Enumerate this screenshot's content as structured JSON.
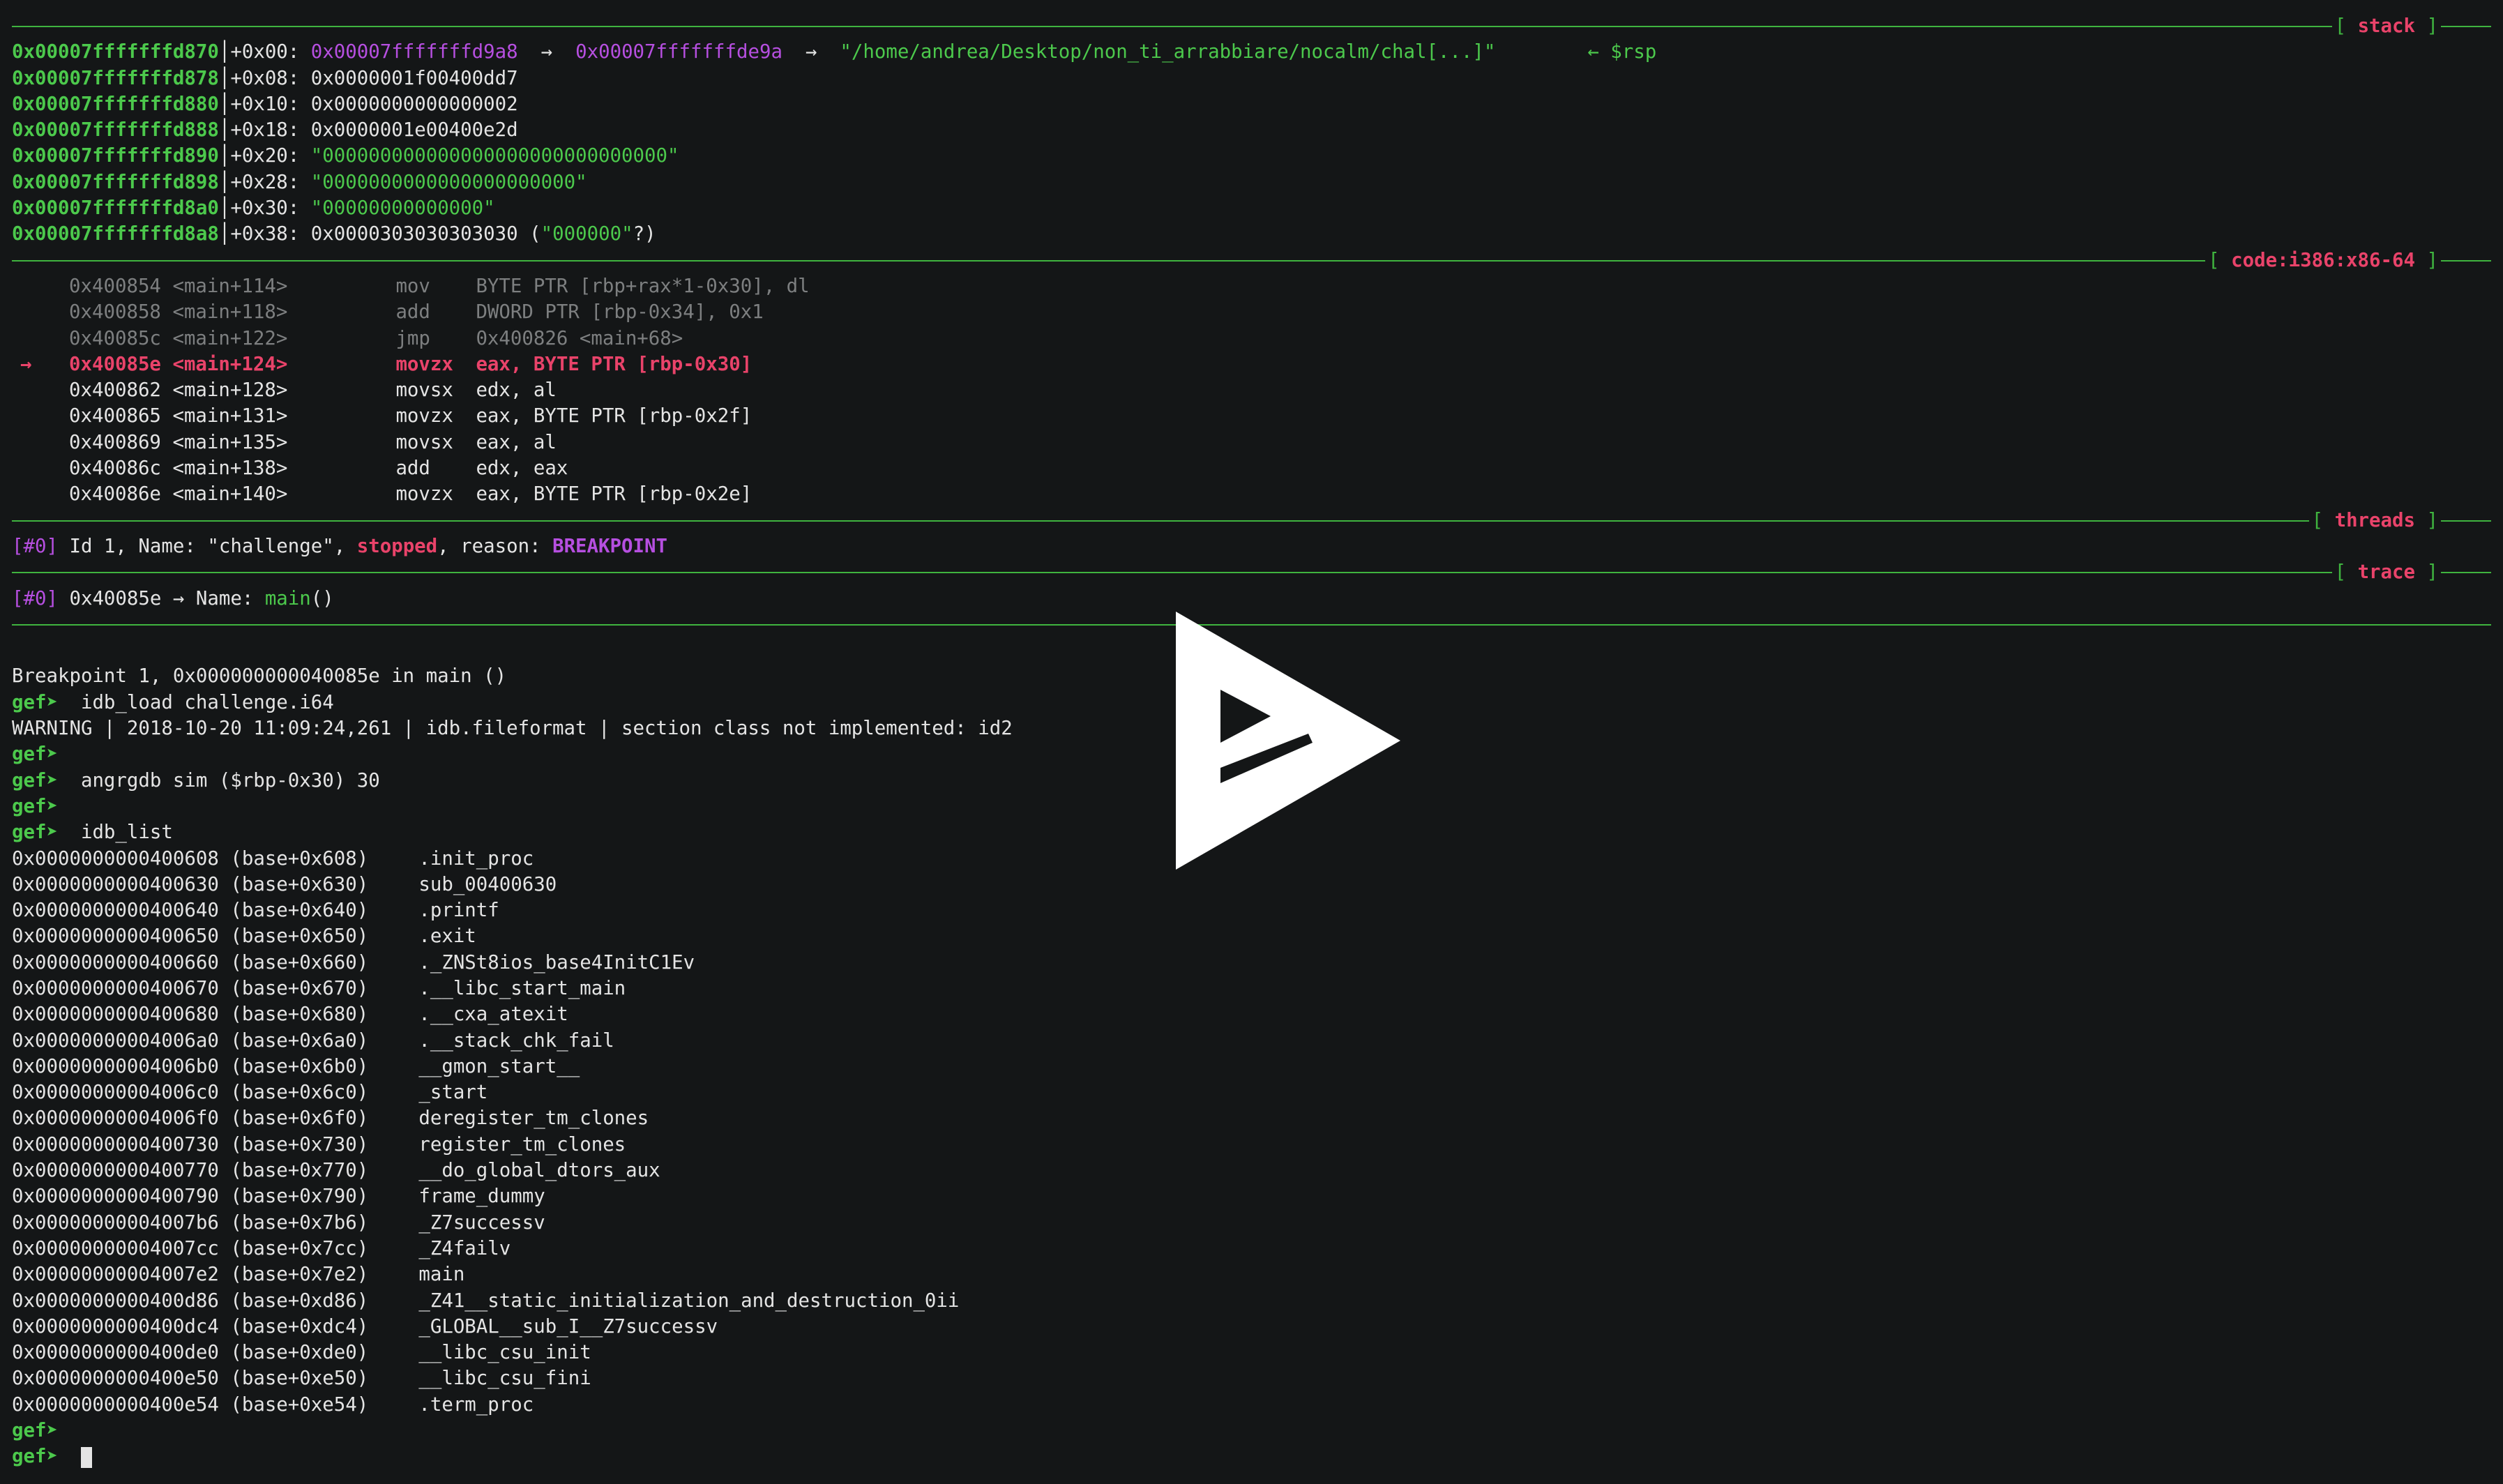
{
  "colors": {
    "background": "#141617",
    "green": "#4cc94c",
    "magenta": "#b64fe0",
    "pink": "#e9436a",
    "dim": "#7d7f80",
    "text": "#e4e4e4"
  },
  "sections": {
    "stack": "stack",
    "code": "code:i386:x86-64",
    "threads": "threads",
    "trace": "trace"
  },
  "stack": [
    {
      "addr": "0x00007fffffffd870",
      "off": "+0x00:",
      "val": "0x00007fffffffd9a8",
      "arrow1": "→",
      "ptr": "0x00007fffffffde9a",
      "arrow2": "→",
      "str": "\"/home/andrea/Desktop/non_ti_arrabbiare/nocalm/chal[...]\"",
      "rsp": "← $rsp"
    },
    {
      "addr": "0x00007fffffffd878",
      "off": "+0x08:",
      "val": "0x0000001f00400dd7"
    },
    {
      "addr": "0x00007fffffffd880",
      "off": "+0x10:",
      "val": "0x0000000000000002"
    },
    {
      "addr": "0x00007fffffffd888",
      "off": "+0x18:",
      "val": "0x0000001e00400e2d"
    },
    {
      "addr": "0x00007fffffffd890",
      "off": "+0x20:",
      "strval": "\"000000000000000000000000000000\""
    },
    {
      "addr": "0x00007fffffffd898",
      "off": "+0x28:",
      "strval": "\"0000000000000000000000\""
    },
    {
      "addr": "0x00007fffffffd8a0",
      "off": "+0x30:",
      "strval": "\"00000000000000\""
    },
    {
      "addr": "0x00007fffffffd8a8",
      "off": "+0x38:",
      "val": "0x0000303030303030",
      "paren_open": "(",
      "inner": "\"000000\"",
      "paren_close": "?)"
    }
  ],
  "code": [
    {
      "arrow": "",
      "addr": "0x400854",
      "sym": "<main+114>",
      "mnem": "mov",
      "ops": "BYTE PTR [rbp+rax*1-0x30], dl",
      "state": "past"
    },
    {
      "arrow": "",
      "addr": "0x400858",
      "sym": "<main+118>",
      "mnem": "add",
      "ops": "DWORD PTR [rbp-0x34], 0x1",
      "state": "past"
    },
    {
      "arrow": "",
      "addr": "0x40085c",
      "sym": "<main+122>",
      "mnem": "jmp",
      "ops": "0x400826 <main+68>",
      "state": "past"
    },
    {
      "arrow": "→",
      "addr": "0x40085e",
      "sym": "<main+124>",
      "mnem": "movzx",
      "ops": "eax, BYTE PTR [rbp-0x30]",
      "state": "current"
    },
    {
      "arrow": "",
      "addr": "0x400862",
      "sym": "<main+128>",
      "mnem": "movsx",
      "ops": "edx, al",
      "state": "next"
    },
    {
      "arrow": "",
      "addr": "0x400865",
      "sym": "<main+131>",
      "mnem": "movzx",
      "ops": "eax, BYTE PTR [rbp-0x2f]",
      "state": "next"
    },
    {
      "arrow": "",
      "addr": "0x400869",
      "sym": "<main+135>",
      "mnem": "movsx",
      "ops": "eax, al",
      "state": "next"
    },
    {
      "arrow": "",
      "addr": "0x40086c",
      "sym": "<main+138>",
      "mnem": "add",
      "ops": "edx, eax",
      "state": "next"
    },
    {
      "arrow": "",
      "addr": "0x40086e",
      "sym": "<main+140>",
      "mnem": "movzx",
      "ops": "eax, BYTE PTR [rbp-0x2e]",
      "state": "next"
    }
  ],
  "threads": {
    "idx": "[#0]",
    "text1": " Id 1, Name: \"challenge\", ",
    "state": "stopped",
    "text2": ", reason: ",
    "reason": "BREAKPOINT"
  },
  "trace": {
    "idx": "[#0]",
    "text1": " 0x40085e → Name: ",
    "func": "main",
    "paren": "()"
  },
  "console": {
    "prompt": "gef➤",
    "breakpoint": "Breakpoint 1, 0x000000000040085e in main ()",
    "cmd1": "  idb_load challenge.i64",
    "warning": "WARNING | 2018-10-20 11:09:24,261 | idb.fileformat | section class not implemented: id2",
    "cmd2": "  angrgdb sim ($rbp-0x30) 30",
    "cmd3": "  idb_list",
    "list": [
      {
        "addr": "0x0000000000400608",
        "base": "(base+0x608)",
        "name": ".init_proc"
      },
      {
        "addr": "0x0000000000400630",
        "base": "(base+0x630)",
        "name": "sub_00400630"
      },
      {
        "addr": "0x0000000000400640",
        "base": "(base+0x640)",
        "name": ".printf"
      },
      {
        "addr": "0x0000000000400650",
        "base": "(base+0x650)",
        "name": ".exit"
      },
      {
        "addr": "0x0000000000400660",
        "base": "(base+0x660)",
        "name": "._ZNSt8ios_base4InitC1Ev"
      },
      {
        "addr": "0x0000000000400670",
        "base": "(base+0x670)",
        "name": ".__libc_start_main"
      },
      {
        "addr": "0x0000000000400680",
        "base": "(base+0x680)",
        "name": ".__cxa_atexit"
      },
      {
        "addr": "0x00000000004006a0",
        "base": "(base+0x6a0)",
        "name": ".__stack_chk_fail"
      },
      {
        "addr": "0x00000000004006b0",
        "base": "(base+0x6b0)",
        "name": "__gmon_start__"
      },
      {
        "addr": "0x00000000004006c0",
        "base": "(base+0x6c0)",
        "name": "_start"
      },
      {
        "addr": "0x00000000004006f0",
        "base": "(base+0x6f0)",
        "name": "deregister_tm_clones"
      },
      {
        "addr": "0x0000000000400730",
        "base": "(base+0x730)",
        "name": "register_tm_clones"
      },
      {
        "addr": "0x0000000000400770",
        "base": "(base+0x770)",
        "name": "__do_global_dtors_aux"
      },
      {
        "addr": "0x0000000000400790",
        "base": "(base+0x790)",
        "name": "frame_dummy"
      },
      {
        "addr": "0x00000000004007b6",
        "base": "(base+0x7b6)",
        "name": "_Z7successv"
      },
      {
        "addr": "0x00000000004007cc",
        "base": "(base+0x7cc)",
        "name": "_Z4failv"
      },
      {
        "addr": "0x00000000004007e2",
        "base": "(base+0x7e2)",
        "name": "main"
      },
      {
        "addr": "0x0000000000400d86",
        "base": "(base+0xd86)",
        "name": "_Z41__static_initialization_and_destruction_0ii"
      },
      {
        "addr": "0x0000000000400dc4",
        "base": "(base+0xdc4)",
        "name": "_GLOBAL__sub_I__Z7successv"
      },
      {
        "addr": "0x0000000000400de0",
        "base": "(base+0xde0)",
        "name": "__libc_csu_init"
      },
      {
        "addr": "0x0000000000400e50",
        "base": "(base+0xe50)",
        "name": "__libc_csu_fini"
      },
      {
        "addr": "0x0000000000400e54",
        "base": "(base+0xe54)",
        "name": ".term_proc"
      }
    ]
  }
}
